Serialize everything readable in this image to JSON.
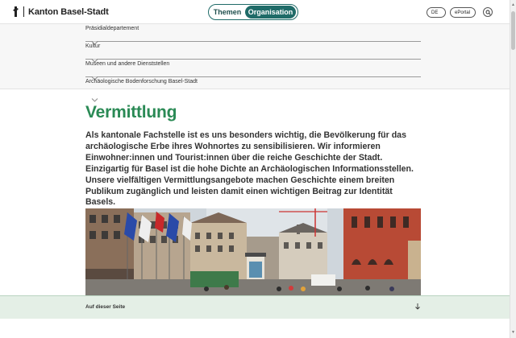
{
  "header": {
    "brand_name": "Kanton Basel-Stadt",
    "toggle": {
      "themen": "Themen",
      "organisation": "Organisation",
      "active": "Organisation"
    },
    "language": "DE",
    "eportal": "ePortal",
    "icons": {
      "logo": "basel-staff-icon",
      "lang": "chevron-down-icon",
      "eportal": "close-icon",
      "search": "search-icon"
    }
  },
  "breadcrumbs": [
    {
      "label": "Präsidialdepartement"
    },
    {
      "label": "Kultur"
    },
    {
      "label": "Museen und andere Dienststellen"
    },
    {
      "label": "Archäologische Bodenforschung Basel-Stadt"
    }
  ],
  "main": {
    "title": "Vermittlung",
    "lead": "Als kantonale Fachstelle ist es uns besonders wichtig, die Bevölkerung für das archäologische Erbe ihres Wohnortes zu sensibilisieren. Wir informieren Einwohner:innen und Tourist:innen über die reiche Geschichte der Stadt. Einzigartig für Basel ist die hohe Dichte an Archäologischen Informationsstellen. Unsere vielfältigen Vermittlungsangebote machen Geschichte einem breiten Publikum zugänglich und leisten damit einen wichtigen Beitrag zur Identität Basels."
  },
  "on_page": {
    "label": "Auf dieser Seite",
    "icon": "arrow-down-icon"
  },
  "colors": {
    "accent": "#1f6b68",
    "title_green": "#2a8a55",
    "footer_bg": "#e4efe6"
  }
}
